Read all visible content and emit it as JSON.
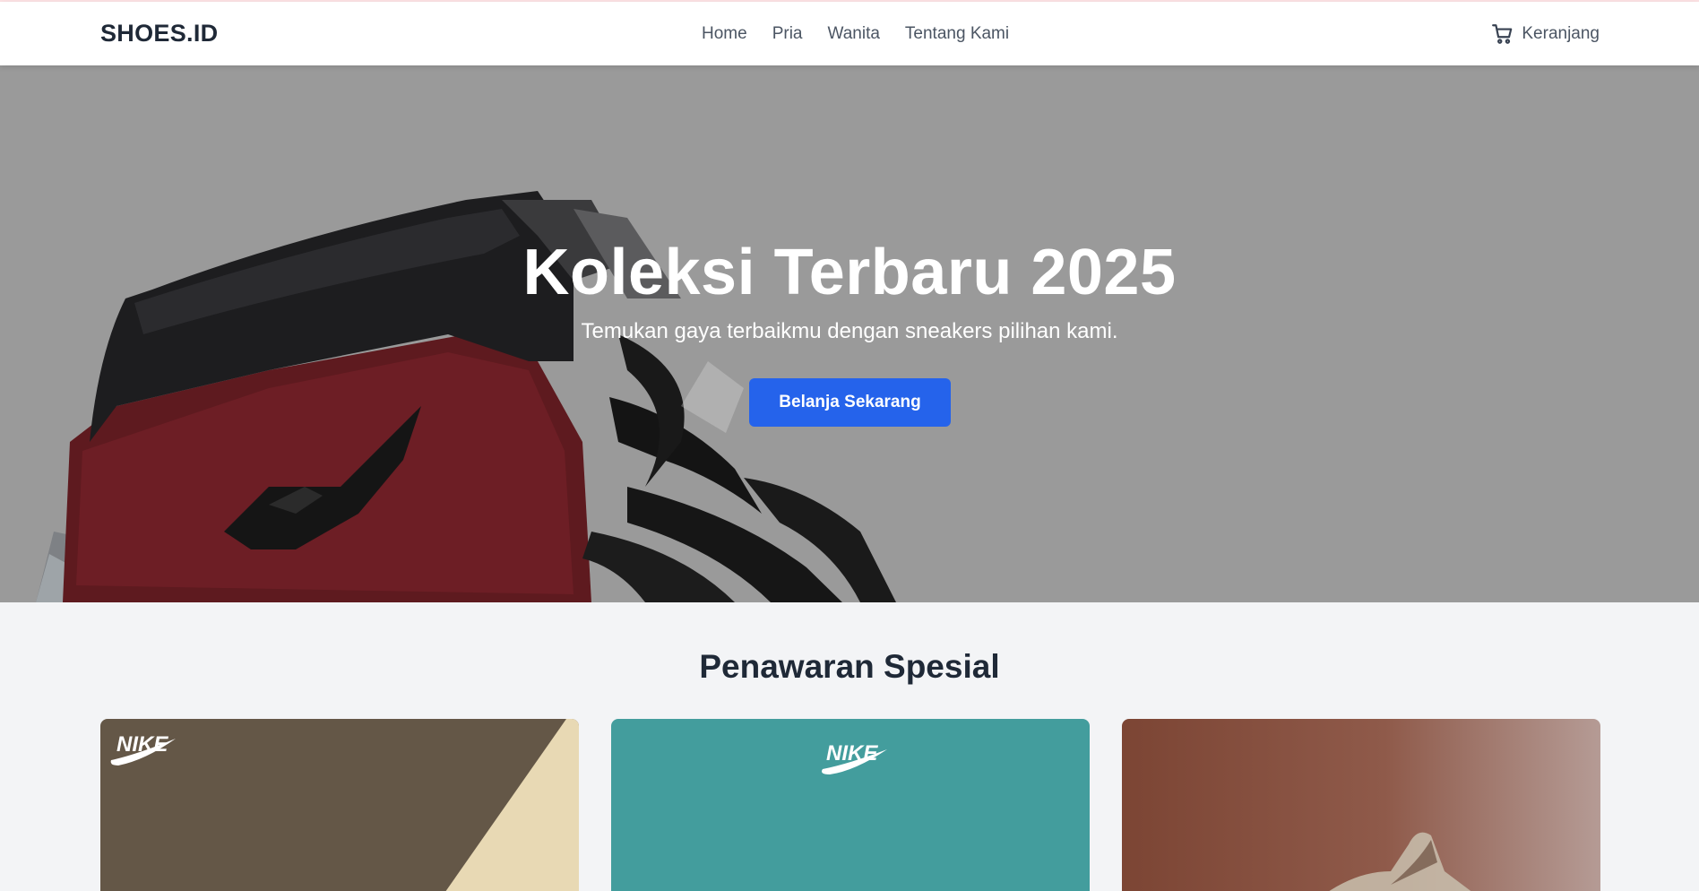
{
  "header": {
    "logo": "SHOES.ID",
    "nav": [
      "Home",
      "Pria",
      "Wanita",
      "Tentang Kami"
    ],
    "cart_label": "Keranjang",
    "cart_icon": "cart-icon"
  },
  "hero": {
    "title": "Koleksi Terbaru 2025",
    "subtitle": "Temukan gaya terbaikmu dengan sneakers pilihan kami.",
    "button_label": "Belanja Sekarang",
    "button_color": "#2563eb"
  },
  "offers": {
    "title": "Penawaran Spesial",
    "cards": [
      {
        "logo_text": "NIKE",
        "bg": "#645747",
        "accent": "#e8d9b4"
      },
      {
        "logo_text": "NIKE",
        "bg": "#439d9d"
      },
      {
        "bg": "#7c4534"
      }
    ]
  }
}
